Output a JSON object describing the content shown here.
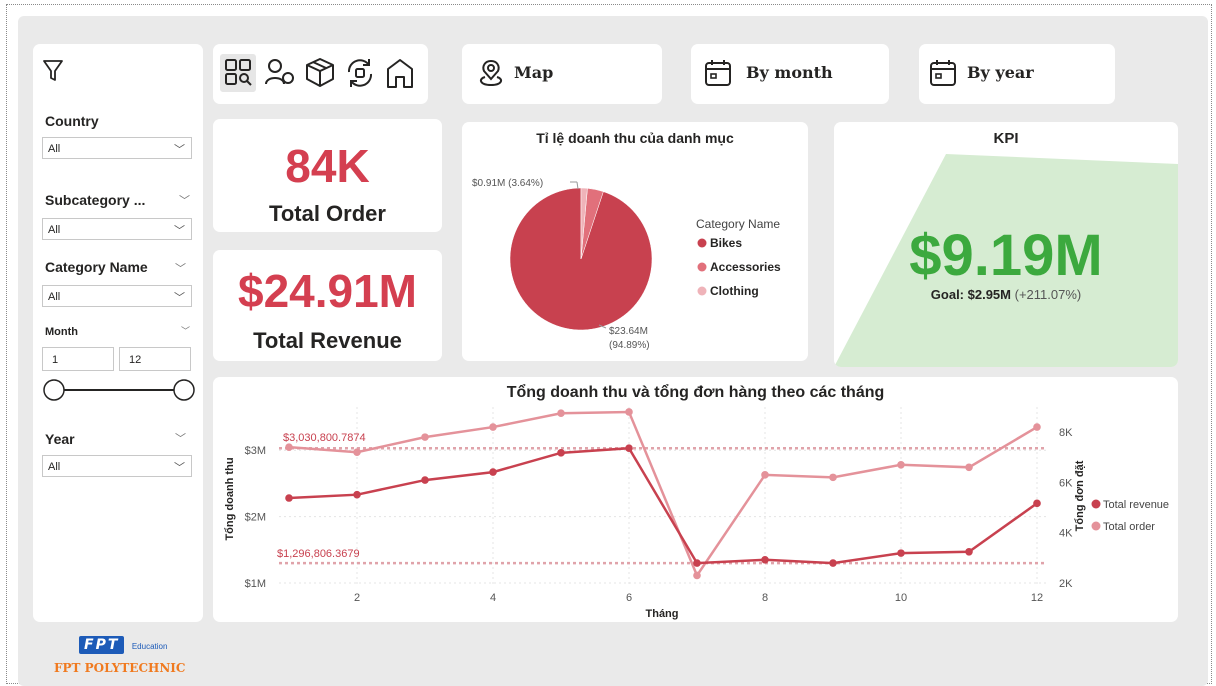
{
  "filters": {
    "country": {
      "title": "Country",
      "value": "All"
    },
    "subcategory": {
      "title": "Subcategory ...",
      "value": "All"
    },
    "category": {
      "title": "Category Name",
      "value": "All"
    },
    "month": {
      "title": "Month",
      "min": "1",
      "max": "12"
    },
    "year": {
      "title": "Year",
      "value": "All"
    }
  },
  "nav": {
    "icons": [
      "dashboard-icon",
      "customers-icon",
      "product-icon",
      "refresh-icon",
      "home-icon"
    ],
    "map_label": "Map",
    "by_month_label": "By month",
    "by_year_label": "By year"
  },
  "cards": {
    "total_order_value": "84K",
    "total_order_label": "Total Order",
    "total_revenue_value": "$24.91M",
    "total_revenue_label": "Total Revenue"
  },
  "kpi": {
    "title": "KPI",
    "value": "$9.19M",
    "goal_label": "Goal: $2.95M",
    "goal_change": "(+211.07%)"
  },
  "colors": {
    "revenue": "#c8414f",
    "order": "#e4929a",
    "kpi_green": "#3ca93e",
    "kpi_area": "#d6ecd2",
    "card_red": "#d43f50"
  },
  "pie": {
    "title": "Tỉ lệ doanh thu của danh mục",
    "legend_title": "Category Name",
    "label_small": "$0.91M (3.64%)",
    "label_big_line1": "$23.64M",
    "label_big_line2": "(94.89%)"
  },
  "line_chart": {
    "title": "Tổng doanh thu và tổng đơn hàng theo các tháng",
    "xlabel": "Tháng",
    "ylabel_left": "Tổng doanh thu",
    "ylabel_right": "Tổng đơn đặt",
    "ref_high_label": "$3,030,800.7874",
    "ref_low_label": "$1,296,806.3679"
  },
  "footer": {
    "logo_text": "FPT",
    "edu": "Education",
    "school": "FPT POLYTECHNIC"
  },
  "chart_data": [
    {
      "type": "pie",
      "title": "Tỉ lệ doanh thu của danh mục",
      "legend_title": "Category Name",
      "categories": [
        "Bikes",
        "Accessories",
        "Clothing"
      ],
      "values": [
        23.64,
        0.91,
        0.36
      ],
      "colors": [
        "#c8414f",
        "#e1707b",
        "#efb3b9"
      ]
    },
    {
      "type": "line",
      "title": "Tổng doanh thu và tổng đơn hàng theo các tháng",
      "xlabel": "Tháng",
      "x": [
        1,
        2,
        3,
        4,
        5,
        6,
        7,
        8,
        9,
        10,
        11,
        12
      ],
      "xticks": [
        "2",
        "4",
        "6",
        "8",
        "10",
        "12"
      ],
      "y_left_ticks": [
        "$1M",
        "$2M",
        "$3M"
      ],
      "y_right_ticks": [
        "2K",
        "4K",
        "6K",
        "8K"
      ],
      "ylim_left": [
        1,
        3.5
      ],
      "ylim_right": [
        2000,
        8600
      ],
      "series": [
        {
          "name": "Total revenue",
          "axis": "left",
          "values": [
            2.28,
            2.33,
            2.55,
            2.67,
            2.96,
            3.03,
            1.3,
            1.35,
            1.3,
            1.45,
            1.47,
            2.2
          ]
        },
        {
          "name": "Total order",
          "axis": "right",
          "values": [
            7400,
            7200,
            7800,
            8200,
            8750,
            8800,
            2300,
            6300,
            6200,
            6700,
            6600,
            8200
          ]
        }
      ],
      "reference_lines": [
        3.03,
        1.3
      ]
    }
  ]
}
